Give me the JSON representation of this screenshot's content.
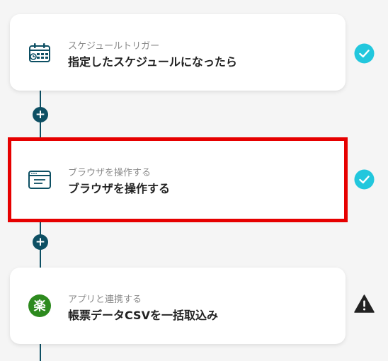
{
  "steps": [
    {
      "category": "スケジュールトリガー",
      "title": "指定したスケジュールになったら",
      "icon": "calendar-clock-icon",
      "status": "complete"
    },
    {
      "category": "ブラウザを操作する",
      "title": "ブラウザを操作する",
      "icon": "browser-window-icon",
      "status": "complete"
    },
    {
      "category": "アプリと連携する",
      "title": "帳票データCSVを一括取込み",
      "icon": "rakuten-logo-icon",
      "status": "warning"
    }
  ],
  "add_step_symbol": "+",
  "app_logo_text": "楽",
  "colors": {
    "connector": "#0d4f63",
    "check": "#22c7dd",
    "warning": "#222222",
    "highlight": "#e60000",
    "app_logo_bg": "#2d8a1e"
  }
}
